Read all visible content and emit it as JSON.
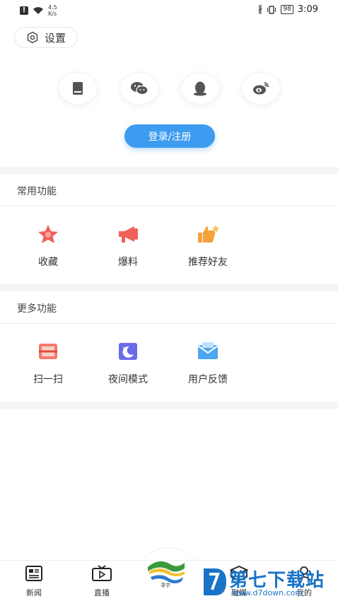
{
  "status_bar": {
    "speed": "4.5",
    "speed_unit": "K/s",
    "battery": "98",
    "time": "3:09"
  },
  "header": {
    "settings_label": "设置"
  },
  "social_login": {
    "icons": [
      "phone-icon",
      "wechat-icon",
      "qq-icon",
      "weibo-icon"
    ]
  },
  "login_button": "登录/注册",
  "common": {
    "title": "常用功能",
    "items": [
      {
        "label": "收藏",
        "icon": "star-icon"
      },
      {
        "label": "爆料",
        "icon": "megaphone-icon"
      },
      {
        "label": "推荐好友",
        "icon": "thumbs-up-icon"
      }
    ]
  },
  "more": {
    "title": "更多功能",
    "items": [
      {
        "label": "扫一扫",
        "icon": "scan-icon"
      },
      {
        "label": "夜间模式",
        "icon": "moon-icon"
      },
      {
        "label": "用户反馈",
        "icon": "mail-icon"
      }
    ]
  },
  "bottom_nav": {
    "items": [
      {
        "label": "新闻",
        "icon": "news-icon"
      },
      {
        "label": "直播",
        "icon": "tv-icon"
      },
      {
        "label": "",
        "icon": "center-logo-icon"
      },
      {
        "label": "融媒",
        "icon": "box-icon"
      },
      {
        "label": "我的",
        "icon": "user-icon"
      }
    ]
  },
  "watermark": {
    "text": "第七下载站",
    "url": "www.d7down.com"
  },
  "colors": {
    "primary": "#3d9cf0",
    "accent_red": "#f0605a",
    "accent_orange": "#f3a23c",
    "accent_purple": "#6a6be8",
    "accent_blue": "#4ca6f0"
  }
}
